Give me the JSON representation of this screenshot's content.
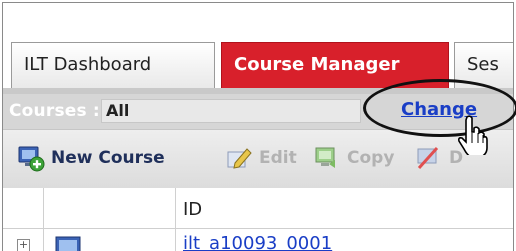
{
  "tabs": [
    {
      "label": "ILT Dashboard"
    },
    {
      "label": "Course Manager",
      "active": true
    },
    {
      "label": "Ses"
    }
  ],
  "filter": {
    "label": "Courses :",
    "value": "All",
    "change_link": "Change"
  },
  "toolbar": {
    "new_course": "New Course",
    "edit": "Edit",
    "copy": "Copy",
    "delete": "D"
  },
  "table": {
    "columns": [
      "ID"
    ],
    "rows": [
      {
        "id": "ilt_a10093_0001"
      }
    ]
  },
  "colors": {
    "active_tab": "#d8202b",
    "link": "#1a3ec6",
    "toolbar_text": "#1f2f5a"
  },
  "icons": [
    "add-course-icon",
    "edit-pencil-icon",
    "copy-icon",
    "delete-icon",
    "hand-cursor-icon",
    "course-row-icon",
    "expand-plus-icon"
  ]
}
